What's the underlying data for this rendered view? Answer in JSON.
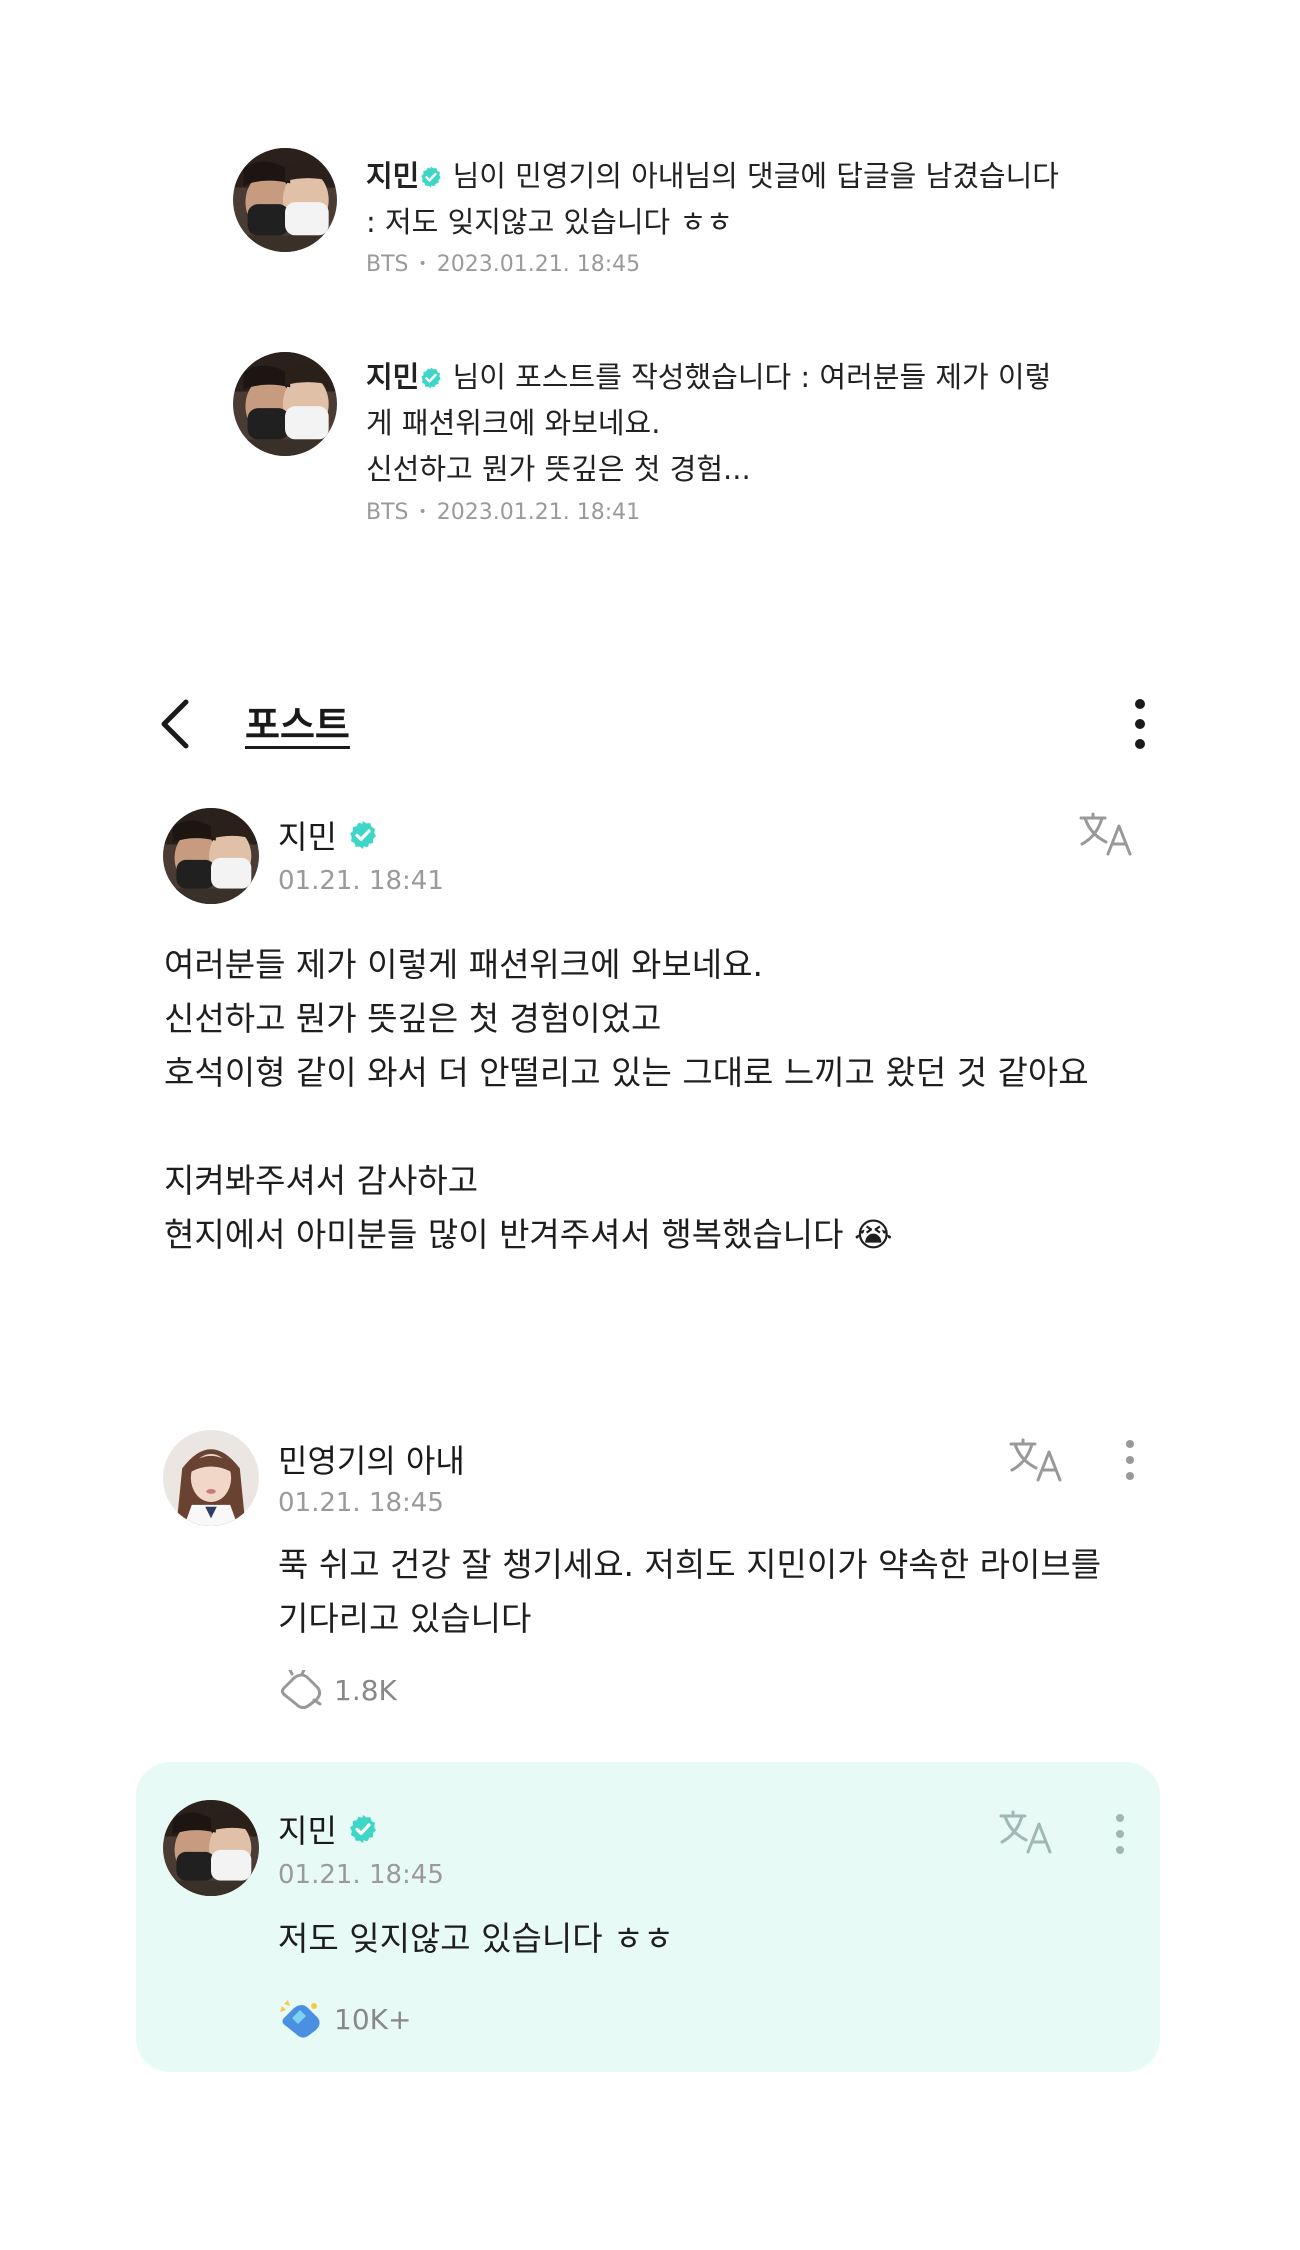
{
  "notifications": [
    {
      "name": "지민",
      "text": "님이 민영기의 아내님의 댓글에 답글을 남겼습니다 : 저도 잊지않고 있습니다 ㅎㅎ",
      "source": "BTS",
      "time": "2023.01.21. 18:45"
    },
    {
      "name": "지민",
      "text_line1": "님이 포스트를 작성했습니다 : 여러분들 제가 이렇게 패션위크에 와보네요.",
      "text_line2": "신선하고 뭔가 뜻깊은 첫 경험...",
      "source": "BTS",
      "time": "2023.01.21. 18:41"
    }
  ],
  "header": {
    "title": "포스트"
  },
  "post": {
    "author": "지민",
    "date": "01.21. 18:41",
    "body": "여러분들 제가 이렇게 패션위크에 와보네요.\n신선하고 뭔가 뜻깊은 첫 경험이었고\n호석이형 같이 와서 더 안떨리고 있는 그대로 느끼고 왔던 것 같아요\n\n지켜봐주셔서 감사하고\n현지에서 아미분들 많이 반겨주셔서 행복했습니다",
    "emoji": "😭"
  },
  "comment": {
    "author": "민영기의 아내",
    "date": "01.21. 18:45",
    "text": "푹 쉬고 건강 잘 챙기세요. 저희도 지민이가 약속한 라이브를 기다리고 있습니다",
    "likes": "1.8K"
  },
  "reply": {
    "author": "지민",
    "date": "01.21. 18:45",
    "text": "저도 잊지않고 있습니다 ㅎㅎ",
    "likes": "10K+"
  },
  "colors": {
    "accent": "#3ed6c7",
    "reply_bg": "#e8faf6",
    "meta_gray": "#9a9a9a"
  }
}
